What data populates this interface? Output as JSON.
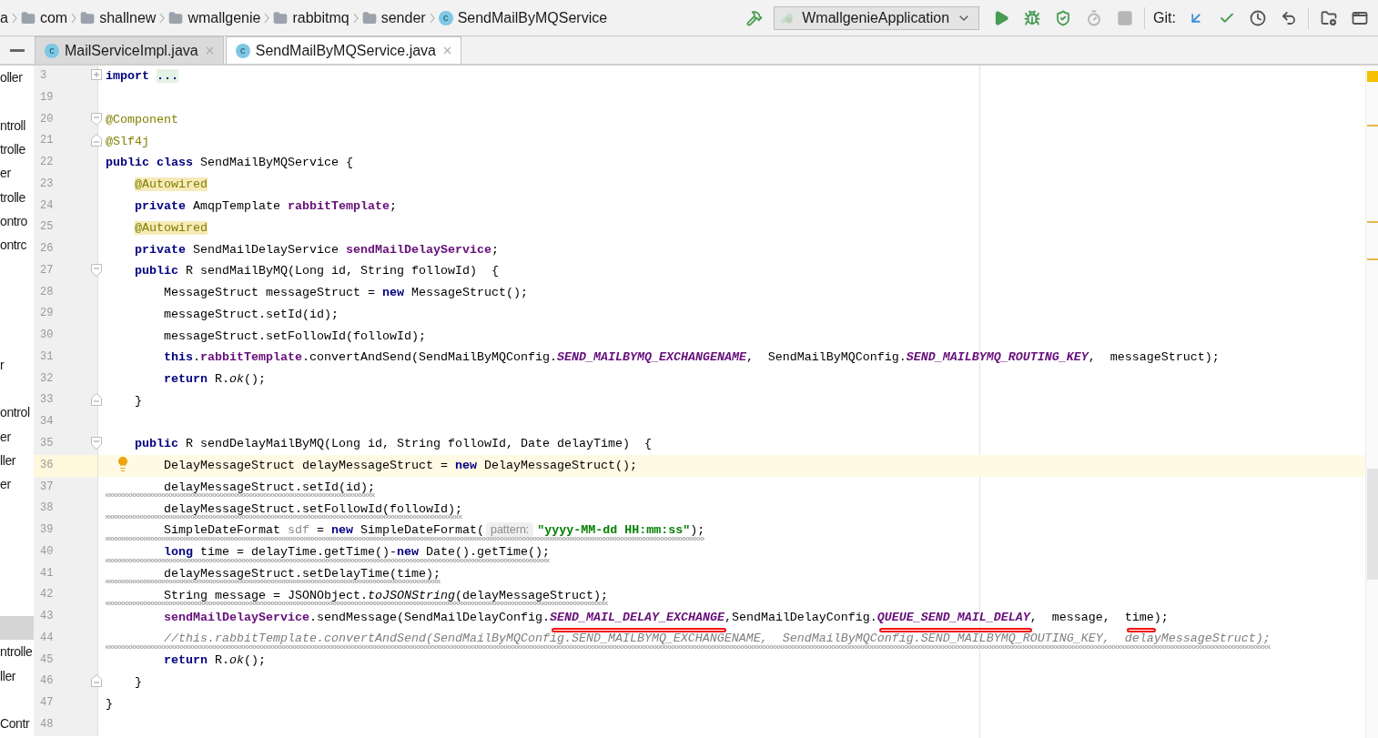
{
  "breadcrumb": [
    {
      "kind": "folder",
      "label": "a"
    },
    {
      "kind": "folder",
      "label": "com"
    },
    {
      "kind": "folder",
      "label": "shallnew"
    },
    {
      "kind": "folder",
      "label": "wmallgenie"
    },
    {
      "kind": "folder",
      "label": "rabbitmq"
    },
    {
      "kind": "folder",
      "label": "sender"
    },
    {
      "kind": "class",
      "badge": "c",
      "label": "SendMailByMQService"
    }
  ],
  "toolbar": {
    "run_config": {
      "label": "WmallgenieApplication"
    },
    "run_actions": [
      {
        "kind": "build",
        "disabled": false
      },
      {
        "kind": "run",
        "disabled": false
      },
      {
        "kind": "debug",
        "disabled": false
      },
      {
        "kind": "coverage",
        "disabled": false
      },
      {
        "kind": "profile",
        "disabled": true
      },
      {
        "kind": "stop",
        "disabled": true
      }
    ],
    "git_label": "Git:",
    "git_actions": [
      {
        "kind": "update",
        "disabled": false
      },
      {
        "kind": "commit",
        "disabled": false
      },
      {
        "kind": "history",
        "disabled": false
      },
      {
        "kind": "revert",
        "disabled": false
      }
    ],
    "extra_actions": [
      {
        "kind": "project-structure",
        "disabled": false
      },
      {
        "kind": "window",
        "disabled": false
      }
    ]
  },
  "tabs": [
    {
      "badge": "c",
      "label": "MailServiceImpl.java",
      "selected": false
    },
    {
      "badge": "c",
      "label": "SendMailByMQService.java",
      "selected": true
    }
  ],
  "sidebar": {
    "items": [
      {
        "label": "oller",
        "selected": false
      },
      {
        "selected": false
      },
      {
        "label": "ntroll",
        "selected": false
      },
      {
        "label": "trolle",
        "selected": false
      },
      {
        "label": "er",
        "selected": false
      },
      {
        "label": "trolle",
        "selected": false
      },
      {
        "label": "ontro",
        "selected": false
      },
      {
        "label": "ontrc",
        "selected": false
      },
      {
        "selected": false
      },
      {
        "selected": false
      },
      {
        "selected": false
      },
      {
        "selected": false
      },
      {
        "label": "r",
        "selected": false
      },
      {
        "selected": false
      },
      {
        "label": "ontrol",
        "selected": false
      },
      {
        "label": "er",
        "selected": false
      },
      {
        "label": "ller",
        "selected": false
      },
      {
        "label": "er",
        "selected": false
      },
      {
        "selected": false
      },
      {
        "selected": false
      },
      {
        "selected": false
      },
      {
        "selected": false
      },
      {
        "selected": false
      },
      {
        "selected": true
      },
      {
        "label": "ntrolle",
        "selected": false
      },
      {
        "label": "ller",
        "selected": false
      },
      {
        "selected": false
      },
      {
        "label": "Contr",
        "selected": false
      }
    ]
  },
  "editor": {
    "lines": [
      {
        "number": "3",
        "folded": true,
        "current": false,
        "warned": false,
        "tokens": [
          {
            "keyword": "import"
          },
          {
            "folded": "..."
          }
        ]
      },
      {
        "number": "19",
        "current": false,
        "warned": false
      },
      {
        "number": "20",
        "fold_start": true,
        "current": false,
        "warned": false,
        "tokens": [
          {
            "annotation": "@Component"
          }
        ]
      },
      {
        "number": "21",
        "fold_end": true,
        "current": false,
        "warned": false,
        "tokens": [
          {
            "annotation": "@Slf4j"
          }
        ]
      },
      {
        "number": "22",
        "current": false,
        "warned": false,
        "tokens": [
          {
            "keyword": "public class"
          },
          {
            "text": " SendMailByMQService {"
          }
        ],
        "children": [
          {
            "number": "23",
            "current": false,
            "warned": false,
            "tokens": [
              {
                "annotation_box": "@Autowired"
              }
            ]
          },
          {
            "number": "24",
            "current": false,
            "warned": false,
            "tokens": [
              {
                "keyword": "private"
              },
              {
                "text": " AmqpTemplate "
              },
              {
                "field": "rabbitTemplate"
              },
              {
                "text": ";"
              }
            ]
          },
          {
            "number": "25",
            "current": false,
            "warned": false,
            "tokens": [
              {
                "annotation_box": "@Autowired"
              }
            ]
          },
          {
            "number": "26",
            "current": false,
            "warned": false,
            "tokens": [
              {
                "keyword": "private"
              },
              {
                "text": " SendMailDelayService "
              },
              {
                "field": "sendMailDelayService"
              },
              {
                "text": ";"
              }
            ]
          },
          {
            "number": "27",
            "fold_start": true,
            "current": false,
            "warned": false,
            "tokens": [
              {
                "keyword": "public"
              },
              {
                "text": " R sendMailByMQ(Long id, String followId)  {"
              }
            ],
            "children": [
              {
                "number": "28",
                "current": false,
                "warned": false,
                "tokens": [
                  {
                    "text": "MessageStruct messageStruct = "
                  },
                  {
                    "keyword": "new"
                  },
                  {
                    "text": " MessageStruct();"
                  }
                ]
              },
              {
                "number": "29",
                "current": false,
                "warned": false,
                "tokens": [
                  {
                    "text": "messageStruct.setId(id);"
                  }
                ]
              },
              {
                "number": "30",
                "current": false,
                "warned": false,
                "tokens": [
                  {
                    "text": "messageStruct.setFollowId(followId);"
                  }
                ]
              },
              {
                "number": "31",
                "current": false,
                "warned": false,
                "tokens": [
                  {
                    "keyword": "this"
                  },
                  {
                    "text": "."
                  },
                  {
                    "field": "rabbitTemplate"
                  },
                  {
                    "text": ".convertAndSend(SendMailByMQConfig."
                  },
                  {
                    "constant": "SEND_MAILBYMQ_EXCHANGENAME"
                  },
                  {
                    "text": ",  SendMailByMQConfig."
                  },
                  {
                    "constant": "SEND_MAILBYMQ_ROUTING_KEY"
                  },
                  {
                    "text": ",  messageStruct);"
                  }
                ]
              },
              {
                "number": "32",
                "current": false,
                "warned": false,
                "tokens": [
                  {
                    "keyword": "return"
                  },
                  {
                    "text": " R."
                  },
                  {
                    "static_call": "ok"
                  },
                  {
                    "text": "();"
                  }
                ]
              }
            ]
          },
          {
            "number": "33",
            "fold_end": true,
            "current": false,
            "warned": false,
            "tokens": [
              {
                "text": "}"
              }
            ]
          },
          {
            "number": "34",
            "current": false,
            "warned": false
          },
          {
            "number": "35",
            "fold_start": true,
            "current": false,
            "warned": false,
            "tokens": [
              {
                "keyword": "public"
              },
              {
                "text": " R sendDelayMailByMQ(Long id, String followId, Date delayTime)  {"
              }
            ],
            "children": [
              {
                "number": "36",
                "current": true,
                "warned": false,
                "tokens": [
                  {
                    "text": "DelayMessageStruct delayMessageStruct = "
                  },
                  {
                    "keyword": "new"
                  },
                  {
                    "text": " DelayMessageStruct();"
                  }
                ]
              },
              {
                "number": "37",
                "current": false,
                "warned": true,
                "tokens": [
                  {
                    "text": "delayMessageStruct.setId(id);"
                  }
                ]
              },
              {
                "number": "38",
                "current": false,
                "warned": true,
                "tokens": [
                  {
                    "text": "delayMessageStruct.setFollowId(followId);"
                  }
                ]
              },
              {
                "number": "39",
                "current": false,
                "warned": true,
                "tokens": [
                  {
                    "text": "SimpleDateFormat "
                  },
                  {
                    "unused": "sdf"
                  },
                  {
                    "text": " = "
                  },
                  {
                    "keyword": "new"
                  },
                  {
                    "text": " SimpleDateFormat("
                  },
                  {
                    "hint": "pattern:"
                  },
                  {
                    "string": "\"yyyy-MM-dd HH:mm:ss\""
                  },
                  {
                    "text": ");"
                  }
                ]
              },
              {
                "number": "40",
                "current": false,
                "warned": true,
                "tokens": [
                  {
                    "keyword": "long"
                  },
                  {
                    "text": " time = delayTime.getTime()-"
                  },
                  {
                    "keyword": "new"
                  },
                  {
                    "text": " Date().getTime();"
                  }
                ]
              },
              {
                "number": "41",
                "current": false,
                "warned": true,
                "tokens": [
                  {
                    "text": "delayMessageStruct.setDelayTime(time);"
                  }
                ]
              },
              {
                "number": "42",
                "current": false,
                "warned": true,
                "tokens": [
                  {
                    "text": "String message = JSONObject."
                  },
                  {
                    "static_call": "toJSONString"
                  },
                  {
                    "text": "(delayMessageStruct);"
                  }
                ]
              },
              {
                "number": "43",
                "current": false,
                "warned": false,
                "tokens": [
                  {
                    "field": "sendMailDelayService"
                  },
                  {
                    "text": ".sendMessage(SendMailDelayConfig."
                  },
                  {
                    "constant": "SEND_MAIL_DELAY_EXCHANGE",
                    "marked": true
                  },
                  {
                    "text": ",SendMailDelayConfig."
                  },
                  {
                    "constant": "QUEUE_SEND_MAIL_DELAY",
                    "marked": true
                  },
                  {
                    "text": ",  message,  "
                  },
                  {
                    "text": "time",
                    "marked": true
                  },
                  {
                    "text": ");"
                  }
                ]
              },
              {
                "number": "44",
                "current": false,
                "warned": true,
                "tokens": [
                  {
                    "comment": "//this.rabbitTemplate.convertAndSend(SendMailByMQConfig.SEND_MAILBYMQ_EXCHANGENAME,  SendMailByMQConfig.SEND_MAILBYMQ_ROUTING_KEY,  delayMessageStruct);"
                  }
                ]
              },
              {
                "number": "45",
                "current": false,
                "warned": false,
                "tokens": [
                  {
                    "keyword": "return"
                  },
                  {
                    "text": " R."
                  },
                  {
                    "static_call": "ok"
                  },
                  {
                    "text": "();"
                  }
                ]
              }
            ]
          },
          {
            "number": "46",
            "fold_end": true,
            "current": false,
            "warned": false,
            "tokens": [
              {
                "text": "}"
              }
            ]
          }
        ]
      },
      {
        "number": "47",
        "current": false,
        "warned": false,
        "tokens": [
          {
            "text": "}"
          }
        ]
      },
      {
        "number": "48",
        "current": false,
        "warned": false
      }
    ]
  }
}
